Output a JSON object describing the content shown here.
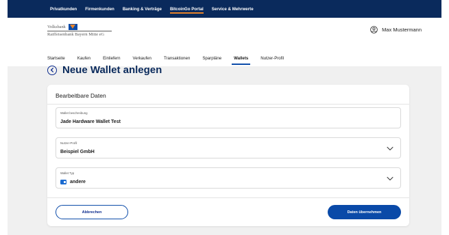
{
  "topnav": {
    "items": [
      {
        "label": "Privatkunden"
      },
      {
        "label": "Firmenkunden"
      },
      {
        "label": "Banking & Verträge"
      },
      {
        "label": "BitcoinGo Portal"
      },
      {
        "label": "Service & Mehrwerte"
      }
    ],
    "active_index": 3
  },
  "brand": {
    "line1": "Volksbank",
    "line2": "Raiffeisenbank Bayern Mitte eG",
    "accent_color": "#e8842a",
    "brand_color": "#0a4aa8"
  },
  "user": {
    "name": "Max Mustermann",
    "icon": "user-circle-icon"
  },
  "subnav": {
    "items": [
      {
        "label": "Startseite"
      },
      {
        "label": "Kaufen"
      },
      {
        "label": "Einliefern"
      },
      {
        "label": "Verkaufen"
      },
      {
        "label": "Transaktionen"
      },
      {
        "label": "Sparpläne"
      },
      {
        "label": "Wallets"
      },
      {
        "label": "Nutzer-Profil"
      }
    ],
    "active_index": 6
  },
  "page": {
    "title": "Neue Wallet anlegen",
    "back_icon": "chevron-left-circle-icon"
  },
  "card": {
    "title": "Bearbeitbare Daten",
    "fields": {
      "description": {
        "label": "Wallet beschreibung",
        "value": "Jade Hardware Wallet Test"
      },
      "profile": {
        "label": "Nutzer-Profil",
        "value": "Beispiel GmbH",
        "icon": "chevron-down-icon"
      },
      "type": {
        "label": "Wallet Typ",
        "value": "andere",
        "icon": "wallet-icon"
      }
    },
    "cancel_label": "Abbrechen",
    "submit_label": "Daten übernehmen"
  },
  "colors": {
    "topbar": "#0a2a5c",
    "primary": "#0a4aa8",
    "background": "#f0f0f0"
  }
}
